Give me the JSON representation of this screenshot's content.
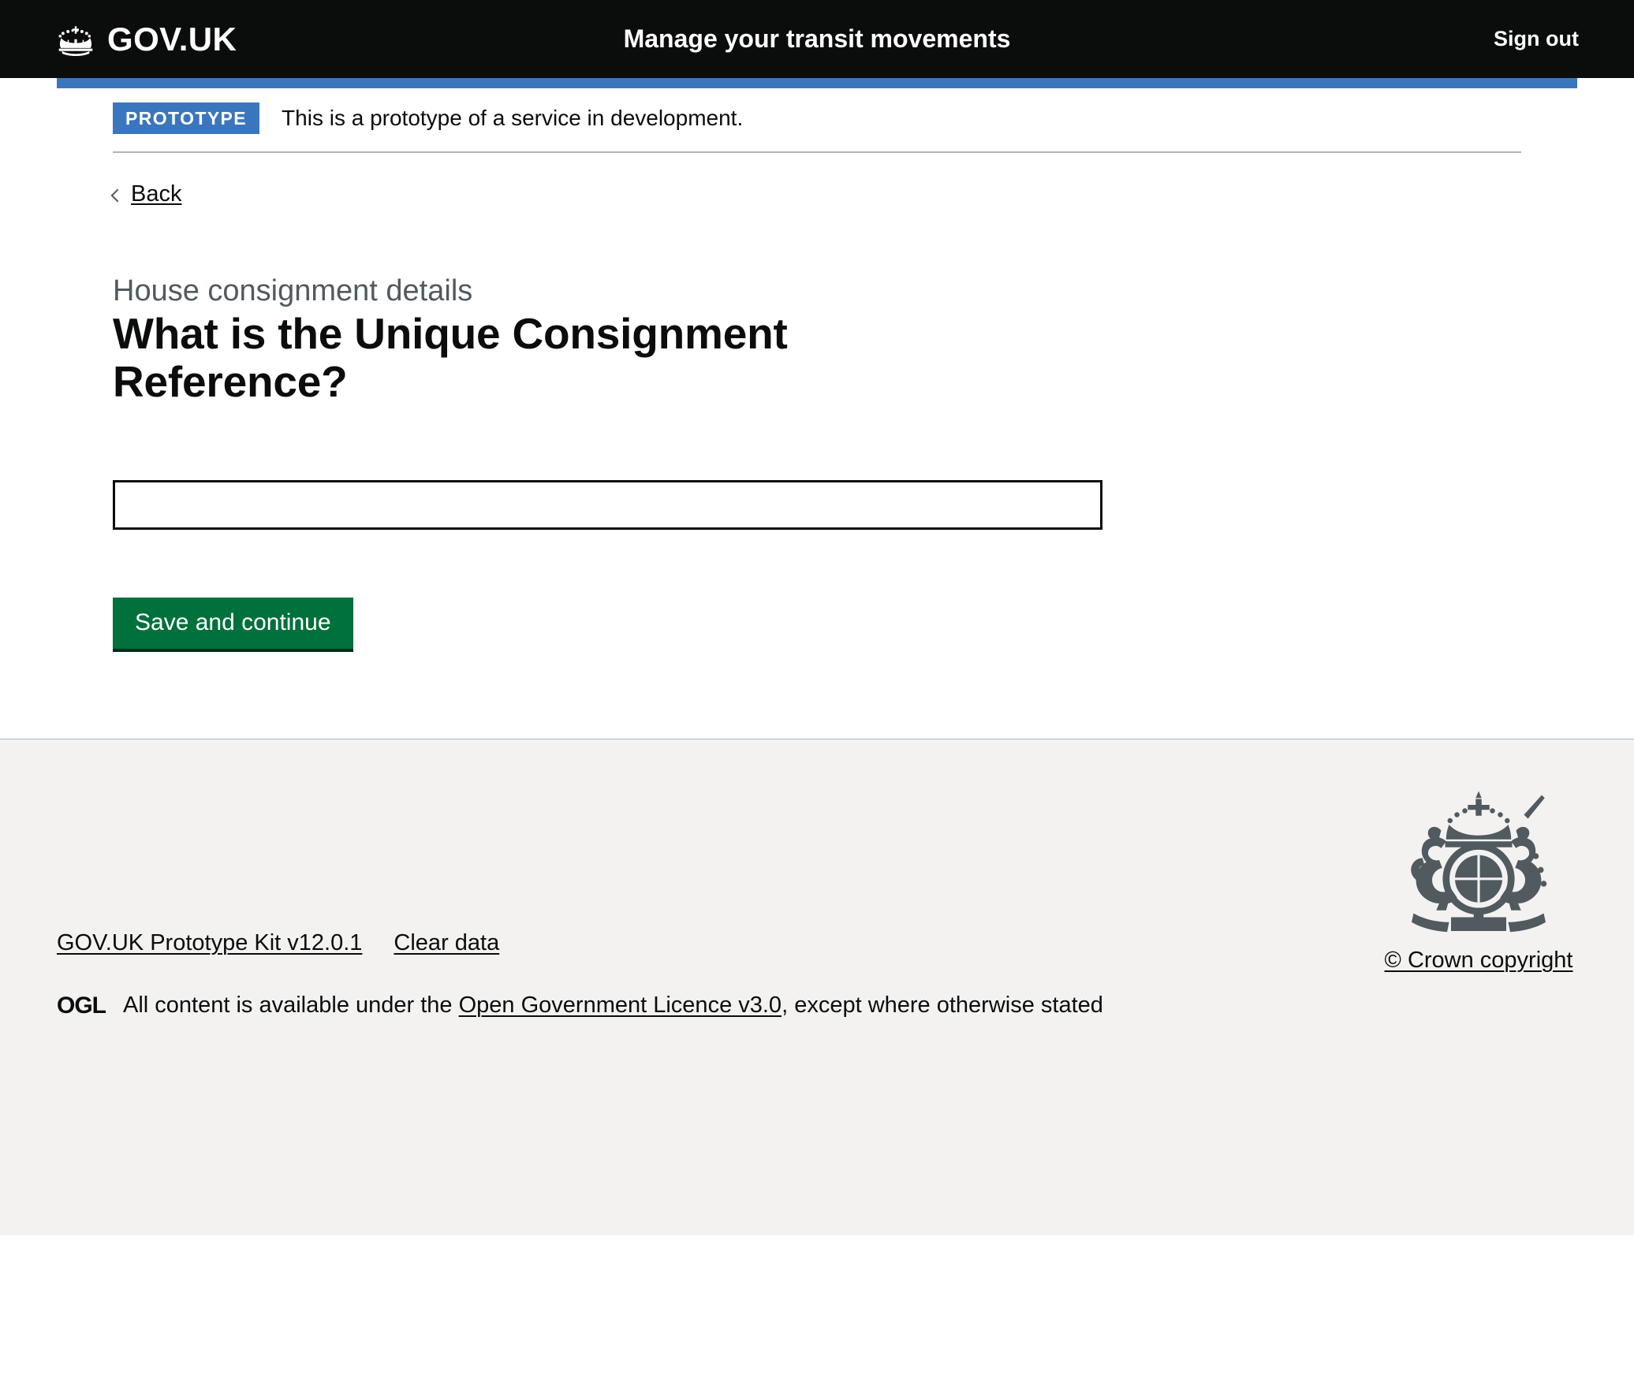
{
  "header": {
    "logo_text": "GOV.UK",
    "logo_icon": "crown-icon",
    "service_name": "Manage your transit movements",
    "sign_out_label": "Sign out",
    "background_color": "#0b0c0c",
    "accent_color": "#3a76bd"
  },
  "phase_banner": {
    "tag_label": "PROTOTYPE",
    "message": "This is a prototype of a service in development.",
    "tag_background": "#3a76bd"
  },
  "back": {
    "label": "Back",
    "icon": "chevron-left-icon"
  },
  "main": {
    "caption": "House consignment details",
    "heading": "What is the Unique Consignment Reference?",
    "input_value": "",
    "input_placeholder": "",
    "submit_label": "Save and continue",
    "submit_color": "#00703c"
  },
  "footer": {
    "links": [
      {
        "label": "GOV.UK Prototype Kit v12.0.1"
      },
      {
        "label": "Clear data"
      }
    ],
    "ogl_logo_text": "OGL",
    "licence_prefix": "All content is available under the",
    "licence_link": "Open Government Licence v3.0",
    "licence_suffix": ", except where otherwise stated",
    "crown_copyright_label": "© Crown copyright",
    "royal_arms_icon": "royal-arms-icon",
    "background_color": "#f3f2f1"
  }
}
